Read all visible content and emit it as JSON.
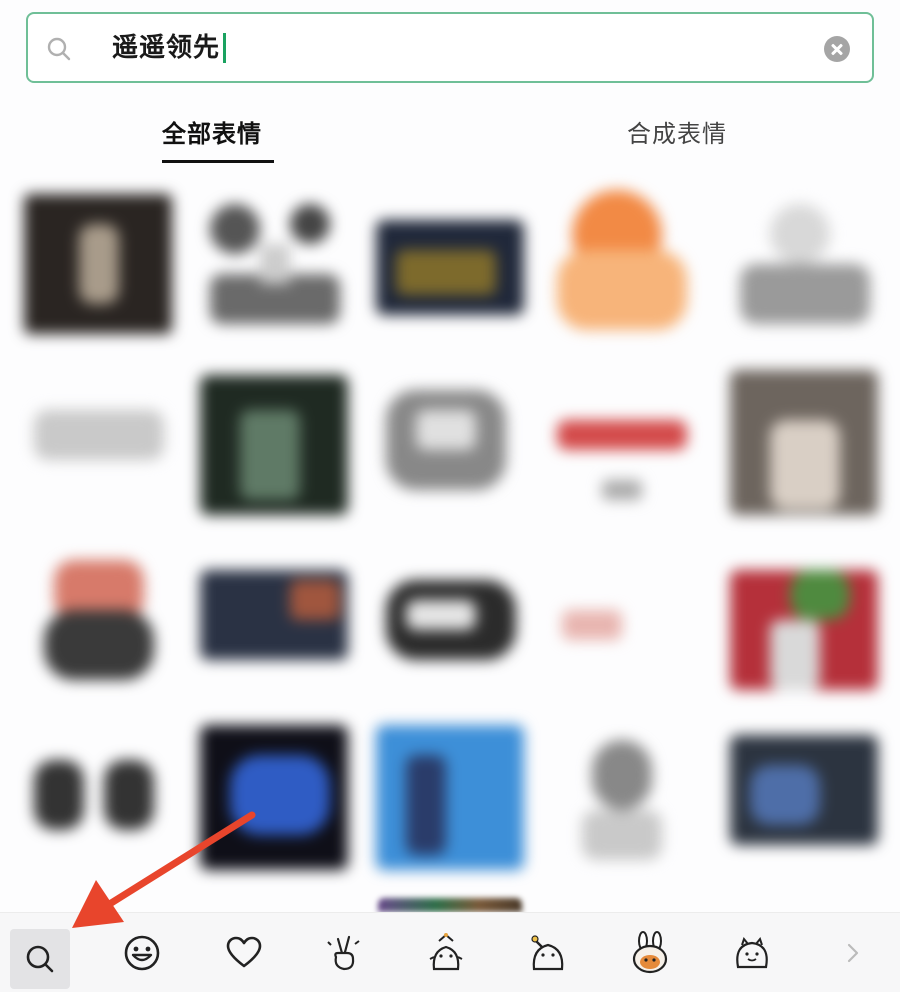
{
  "search": {
    "query": "遥遥领先",
    "icon": "search-icon",
    "clear_icon": "clear-icon"
  },
  "tabs": [
    {
      "label": "全部表情",
      "active": true
    },
    {
      "label": "合成表情",
      "active": false
    }
  ],
  "toolbar": {
    "items": [
      {
        "icon": "search-icon",
        "selected": true
      },
      {
        "icon": "emoji-face-icon"
      },
      {
        "icon": "heart-icon"
      },
      {
        "icon": "peace-hand-icon"
      },
      {
        "icon": "sticker-pack-icon"
      },
      {
        "icon": "sticker-pack-icon"
      },
      {
        "icon": "rabbit-sticker-icon"
      },
      {
        "icon": "sticker-pack-icon"
      },
      {
        "icon": "chevron-right-icon"
      }
    ]
  },
  "annotation": {
    "arrow_color": "#e8452c",
    "points_to": "search-icon"
  },
  "colors": {
    "accent_border": "#6fbf97",
    "caret": "#1aa260"
  }
}
